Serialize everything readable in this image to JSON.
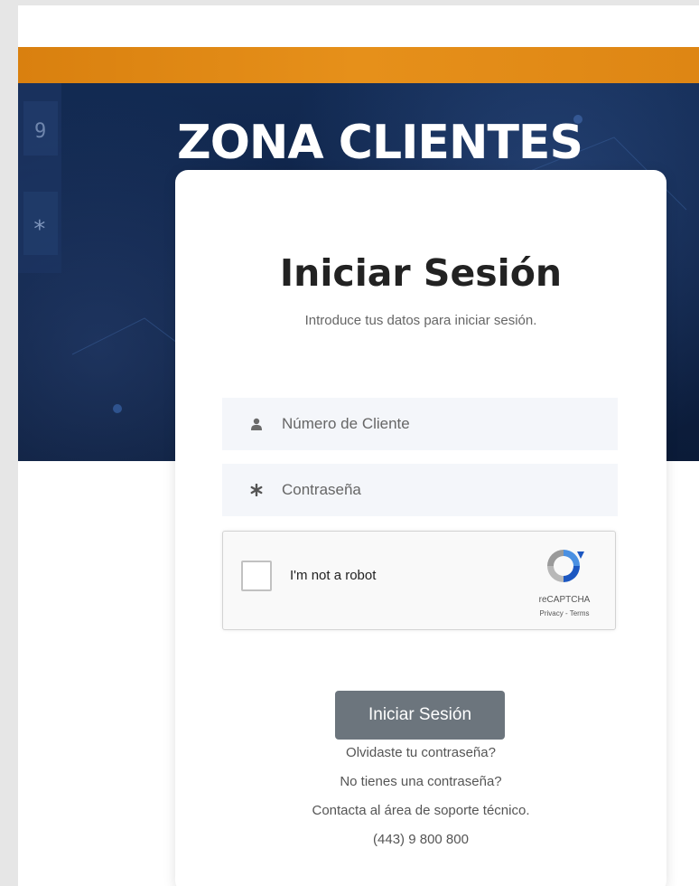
{
  "hero": {
    "title": "ZONA CLIENTES"
  },
  "login": {
    "title": "Iniciar Sesión",
    "subtitle": "Introduce tus datos para iniciar sesión.",
    "client_field": {
      "placeholder": "Número de Cliente",
      "value": "",
      "icon": "user-icon"
    },
    "password_field": {
      "placeholder": "Contraseña",
      "value": "",
      "icon": "asterisk-icon"
    },
    "captcha": {
      "label": "I'm not a robot",
      "brand": "reCAPTCHA",
      "links": "Privacy - Terms",
      "checked": false
    },
    "submit_label": "Iniciar Sesión",
    "forgot_password": "Olvidaste tu contraseña?",
    "no_password": "No tienes una contraseña?",
    "contact_support": "Contacta al área de soporte técnico.",
    "phone": "(443) 9 800 800"
  },
  "colors": {
    "accent_orange": "#de8614",
    "hero_navy": "#0f2347",
    "button_gray": "#6c757d"
  }
}
